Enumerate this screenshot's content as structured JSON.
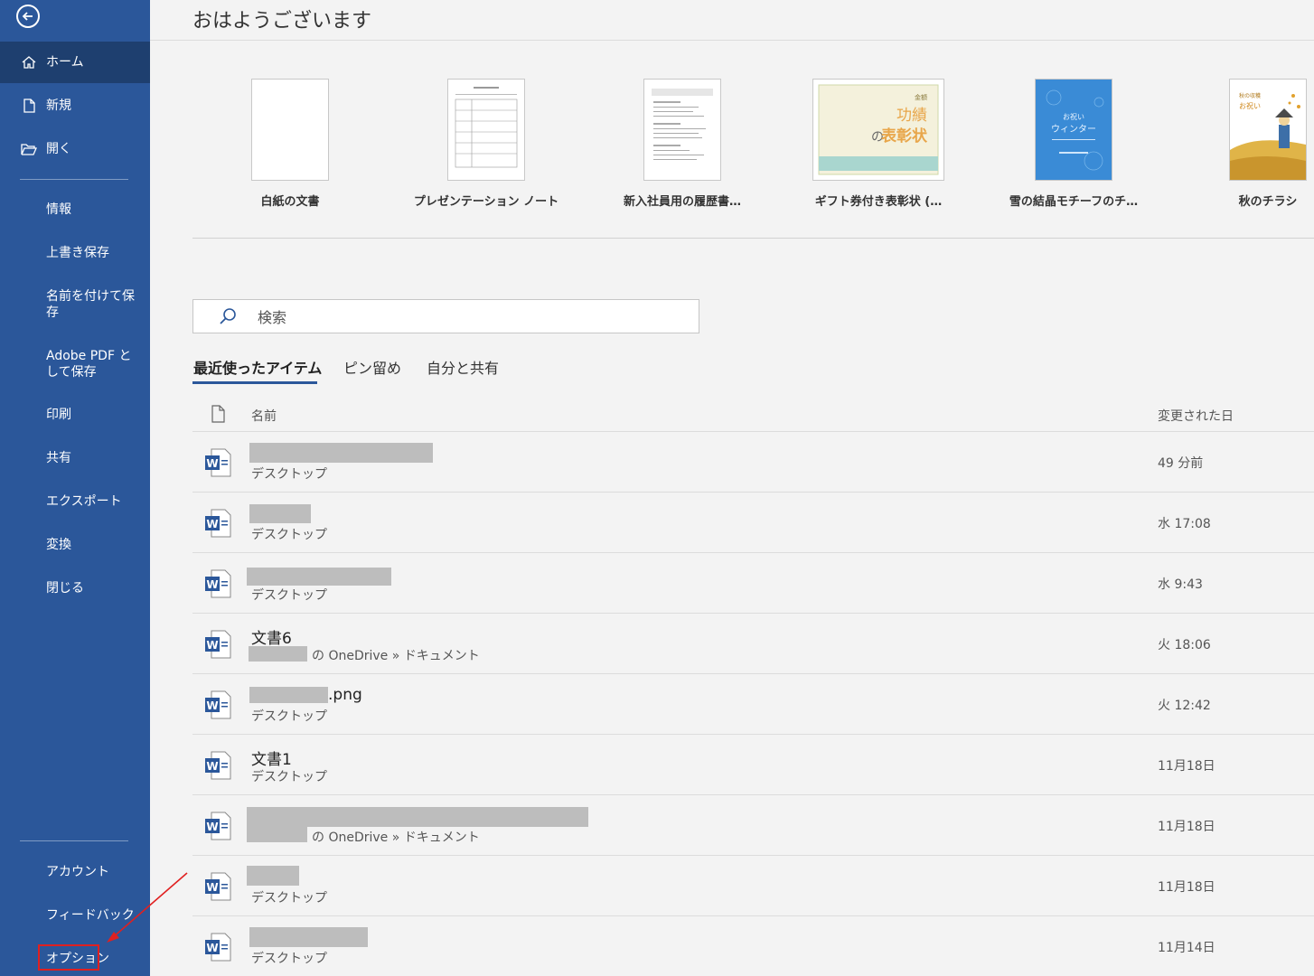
{
  "sidebar": {
    "home": "ホーム",
    "new": "新規",
    "open": "開く",
    "info": "情報",
    "save": "上書き保存",
    "save_as": "名前を付けて保存",
    "adobe_pdf": "Adobe PDF として保存",
    "print": "印刷",
    "share": "共有",
    "export": "エクスポート",
    "transform": "変換",
    "close": "閉じる",
    "account": "アカウント",
    "feedback": "フィードバック",
    "options": "オプション"
  },
  "main": {
    "greeting": "おはようございます",
    "templates": [
      {
        "label": "白紙の文書"
      },
      {
        "label": "プレゼンテーション ノート"
      },
      {
        "label": "新入社員用の履歴書…"
      },
      {
        "label": "ギフト券付き表彰状 (…"
      },
      {
        "label": "雪の結晶モチーフのチ…"
      },
      {
        "label": "秋のチラシ"
      }
    ],
    "thumb_text": {
      "award_small": "金額",
      "award_title1": "功績",
      "award_no": "の",
      "award_title2": "表彰状",
      "winter_line1": "お祝い",
      "winter_line2": "ウィンター",
      "autumn_line1": "秋の収穫",
      "autumn_line2": "お祝い"
    },
    "search_placeholder": "検索",
    "tabs": [
      "最近使ったアイテム",
      "ピン留め",
      "自分と共有"
    ],
    "columns": {
      "name": "名前",
      "modified": "変更された日"
    },
    "files": [
      {
        "name": "",
        "path": "デスクトップ",
        "date": "49 分前"
      },
      {
        "name": "",
        "path": "デスクトップ",
        "date": "水 17:08"
      },
      {
        "name": "",
        "path": "デスクトップ",
        "date": "水 9:43"
      },
      {
        "name": "文書6",
        "path": "の OneDrive » ドキュメント",
        "date": "火 18:06"
      },
      {
        "name": ".png",
        "path": "デスクトップ",
        "date": "火 12:42"
      },
      {
        "name": "文書1",
        "path": "デスクトップ",
        "date": "11月18日"
      },
      {
        "name": "",
        "path": "の OneDrive » ドキュメント",
        "date": "11月18日"
      },
      {
        "name": "",
        "path": "デスクトップ",
        "date": "11月18日"
      },
      {
        "name": "",
        "path": "デスクトップ",
        "date": "11月14日"
      }
    ]
  },
  "colors": {
    "sidebar": "#2b579a",
    "sidebar_active": "#1e3f6f",
    "highlight": "#e02020",
    "word_blue": "#2b579a"
  }
}
